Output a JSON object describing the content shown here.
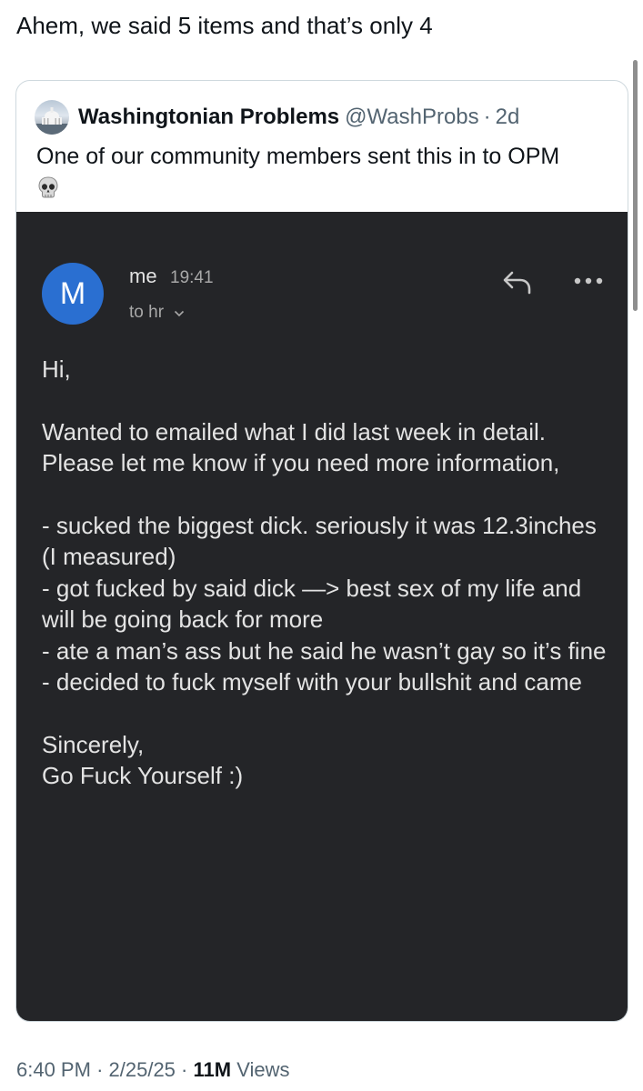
{
  "tweet": {
    "text": "Ahem, we said 5 items and that’s only 4"
  },
  "quoted": {
    "name": "Washingtonian Problems",
    "handle": "@WashProbs",
    "separator": "·",
    "age": "2d",
    "text": "One of our community members sent this in to OPM",
    "emoji": "skull-emoji"
  },
  "email": {
    "avatar_letter": "M",
    "sender": "me",
    "time": "19:41",
    "to": "to hr",
    "body": "Hi,\n\nWanted to emailed what I did last week in detail. Please let me know if you need more information,\n\n- sucked the biggest dick. seriously it was 12.3inches (I measured)\n- got fucked by said dick —> best sex of my life and will be going back for more\n- ate a man’s ass but he said he wasn’t gay so it’s fine\n- decided to fuck myself with your bullshit and came\n\nSincerely,\nGo Fuck Yourself :)",
    "colors": {
      "background": "#242528",
      "avatar": "#2a6fd1",
      "text": "#e3e3e3"
    }
  },
  "meta": {
    "time": "6:40 PM",
    "sep1": "·",
    "date": "2/25/25",
    "sep2": "·",
    "views_count": "11M",
    "views_label": "Views"
  }
}
